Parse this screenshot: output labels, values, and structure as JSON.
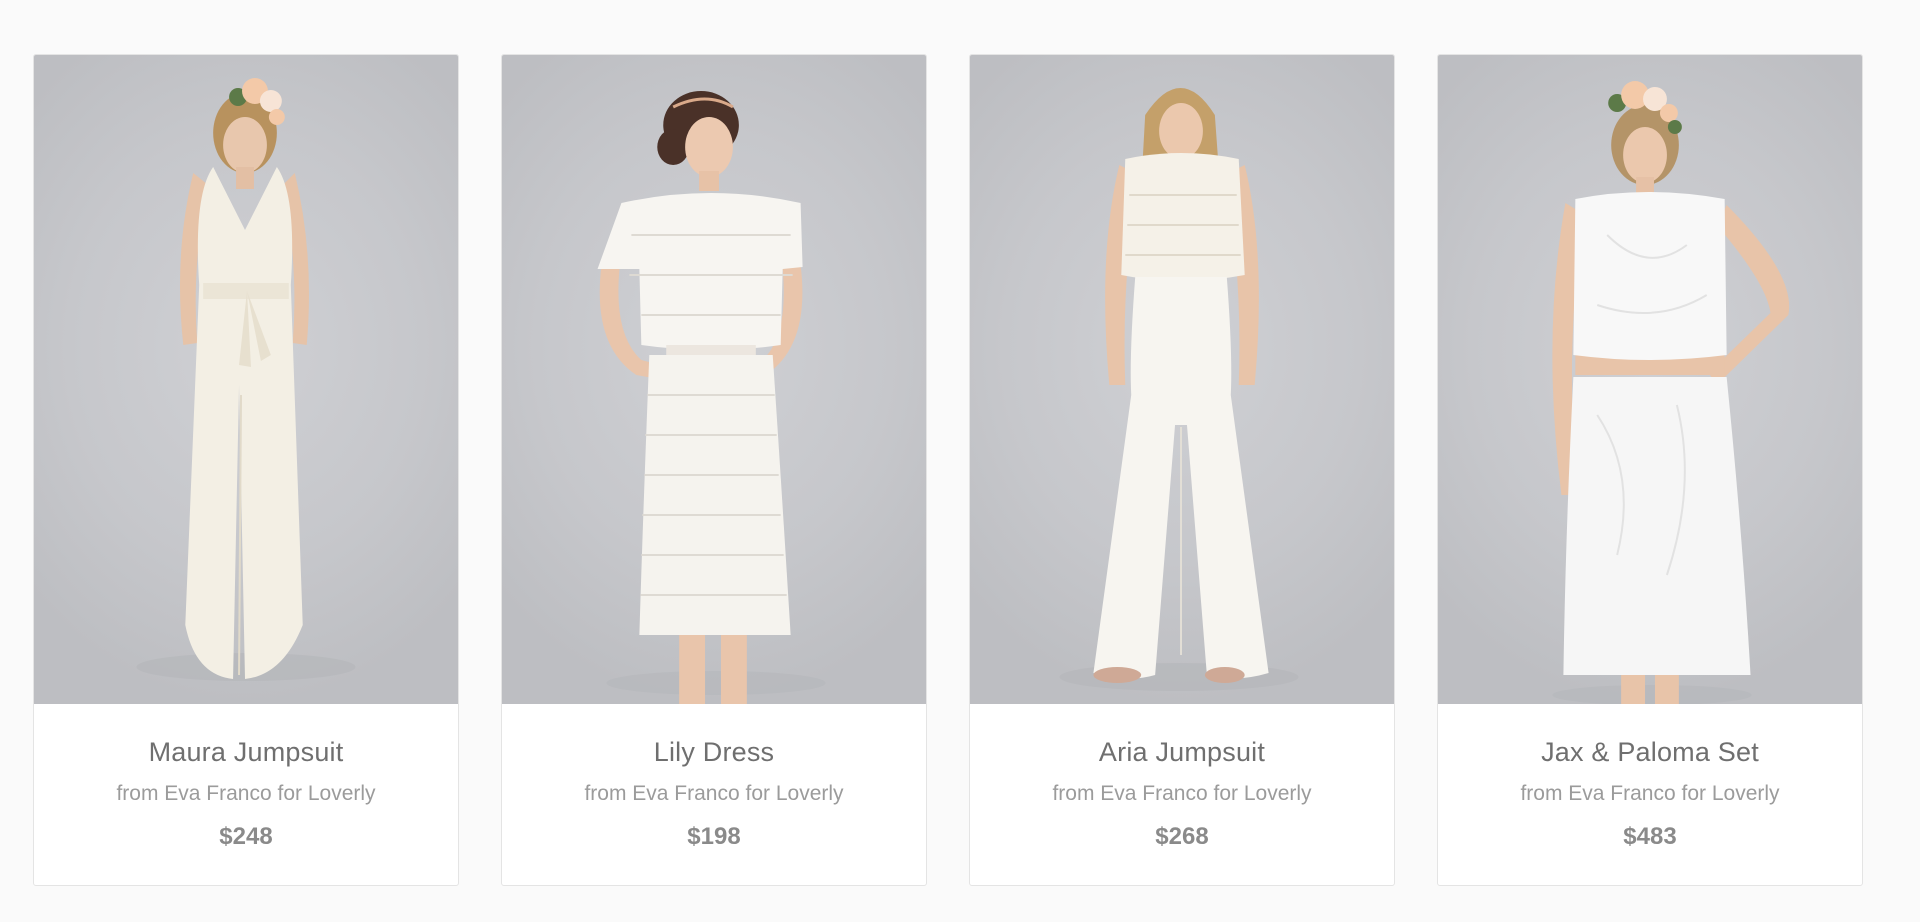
{
  "products": [
    {
      "name": "Maura Jumpsuit",
      "brand": "from Eva Franco for Loverly",
      "price": "$248",
      "outfit": "halter-jumpsuit",
      "hair": "#b8925e",
      "flower": true
    },
    {
      "name": "Lily Dress",
      "brand": "from Eva Franco for Loverly",
      "price": "$198",
      "outfit": "lace-dress",
      "hair": "#4a3128",
      "flower": false
    },
    {
      "name": "Aria Jumpsuit",
      "brand": "from Eva Franco for Loverly",
      "price": "$268",
      "outfit": "lace-top-pants",
      "hair": "#c4a06a",
      "flower": false
    },
    {
      "name": "Jax & Paloma Set",
      "brand": "from Eva Franco for Loverly",
      "price": "$483",
      "outfit": "crop-skirt",
      "hair": "#b49468",
      "flower": true
    }
  ]
}
